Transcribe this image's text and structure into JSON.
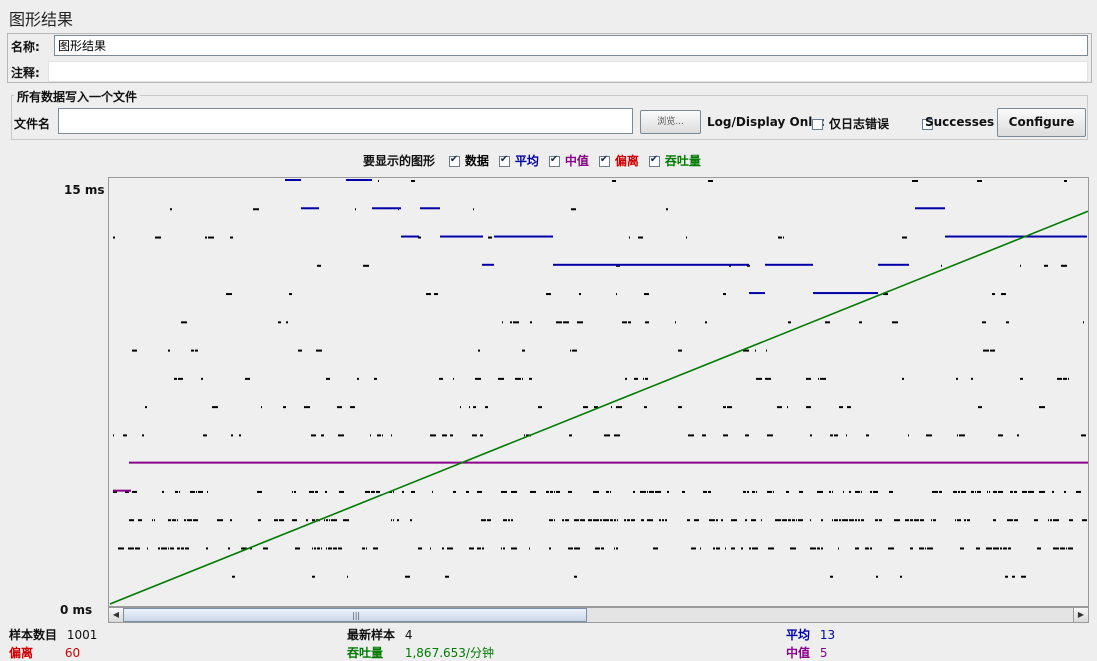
{
  "title": "图形结果",
  "name_label": "名称:",
  "name_value": "图形结果",
  "comment_label": "注释:",
  "comment_value": "",
  "file_group_title": "所有数据写入一个文件",
  "filename_label": "文件名",
  "filename_value": "",
  "browse_label": "浏览...",
  "log_display_label": "Log/Display Only:",
  "errors_only_label": "仅日志错误",
  "errors_only_checked": false,
  "successes_label": "Successes",
  "successes_checked": false,
  "configure_label": "Configure",
  "graphs_to_display_label": "要显示的图形",
  "legend": [
    {
      "key": "data",
      "label": "数据",
      "color": "#000000",
      "checked": true
    },
    {
      "key": "average",
      "label": "平均",
      "color": "#0000a8",
      "checked": true
    },
    {
      "key": "median",
      "label": "中值",
      "color": "#8a008a",
      "checked": true
    },
    {
      "key": "deviation",
      "label": "偏离",
      "color": "#d00000",
      "checked": true
    },
    {
      "key": "throughput",
      "label": "吞吐量",
      "color": "#007a00",
      "checked": true
    }
  ],
  "chart_data": {
    "type": "line",
    "y_axis": {
      "top_label": "15 ms",
      "bottom_label": "0 ms",
      "ylim": [
        0,
        15
      ]
    },
    "series": [
      {
        "name": "中值",
        "color": "#8a008a",
        "values": [
          5,
          5
        ]
      },
      {
        "name": "吞吐量",
        "color": "#007a00",
        "values": [
          0,
          1867.653
        ]
      }
    ],
    "average_levels_ms": [
      14,
      13,
      12,
      11,
      10
    ],
    "grid": false
  },
  "stats": {
    "samples_label": "样本数目",
    "samples_value": "1001",
    "latest_label": "最新样本",
    "latest_value": "4",
    "average_label": "平均",
    "average_value": "13",
    "deviation_label": "偏离",
    "deviation_value": "60",
    "throughput_label": "吞吐量",
    "throughput_value": "1,867.653/分钟",
    "median_label": "中值",
    "median_value": "5"
  }
}
